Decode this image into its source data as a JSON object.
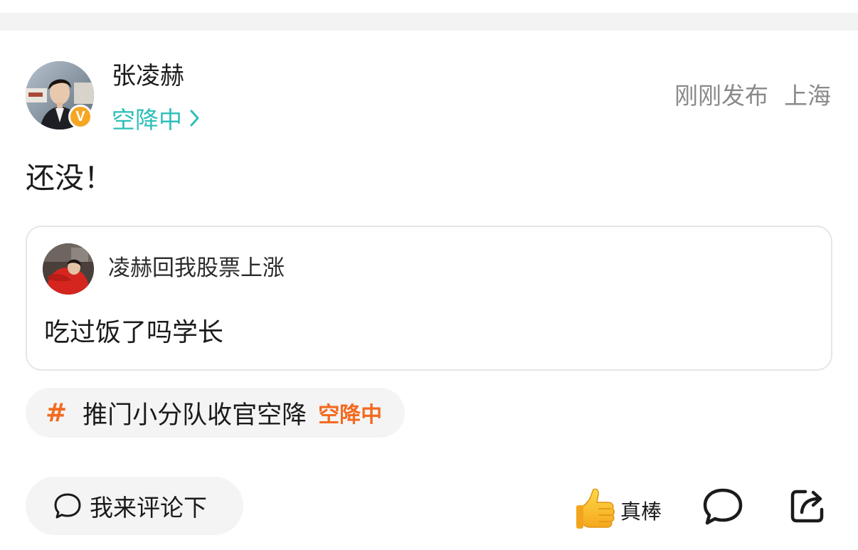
{
  "post": {
    "author": {
      "name": "张凌赫",
      "status_label": "空降中",
      "verified_mark": "V"
    },
    "meta": {
      "time": "刚刚发布",
      "location": "上海"
    },
    "text": "还没！",
    "quoted_comment": {
      "user": "凌赫回我股票上涨",
      "text": "吃过饭了吗学长"
    },
    "topic": {
      "hash_symbol": "#",
      "name": "推门小分队收官空降",
      "tag": "空降中"
    }
  },
  "actions": {
    "comment_placeholder": "我来评论下",
    "like_label": "真棒"
  },
  "colors": {
    "accent_teal": "#2cbfb9",
    "topic_orange": "#f26b21",
    "verified_badge": "#f6a623",
    "meta_gray": "#8a8a8a",
    "chip_bg": "#f4f4f4"
  },
  "icons": {
    "status_chevron": "chevron-right-icon",
    "comment_input": "speech-bubble-icon",
    "like": "thumbs-up-icon",
    "comment": "speech-bubble-icon",
    "share": "share-icon"
  }
}
